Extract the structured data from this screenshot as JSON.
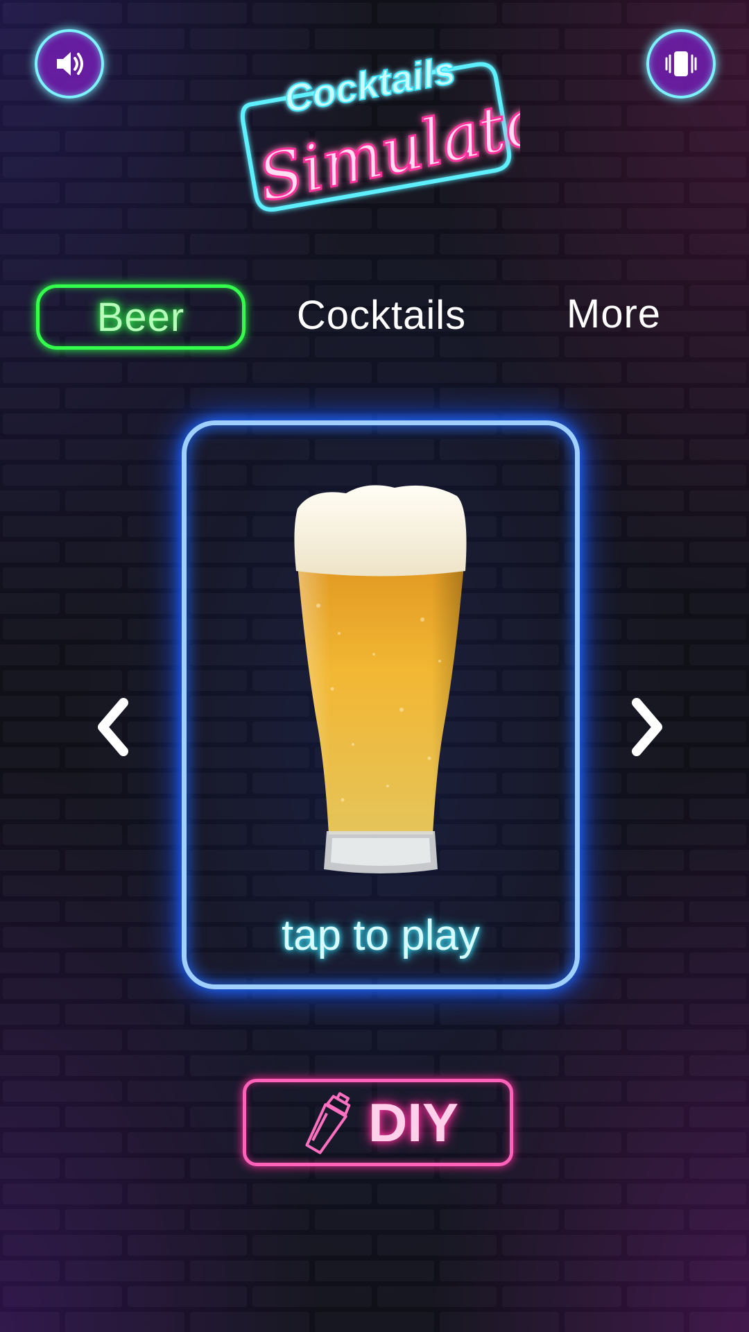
{
  "app": {
    "logo": {
      "line1": "Cocktails",
      "line2": "Simulator"
    }
  },
  "top_bar": {
    "sound_icon": "speaker-volume-icon",
    "vibration_icon": "phone-vibrate-icon"
  },
  "tabs": [
    {
      "label": "Beer",
      "active": true
    },
    {
      "label": "Cocktails",
      "active": false
    },
    {
      "label": "More",
      "active": false
    }
  ],
  "card": {
    "image": "beer-glass",
    "action_label": "tap to play"
  },
  "nav": {
    "prev_icon": "chevron-left-icon",
    "next_icon": "chevron-right-icon"
  },
  "diy_button": {
    "icon": "cocktail-shaker-icon",
    "label": "DIY"
  },
  "colors": {
    "cyan_neon": "#7cf3ff",
    "pink_neon": "#ff2f9b",
    "green_neon": "#2eff48",
    "blue_neon": "#1e6bff"
  }
}
